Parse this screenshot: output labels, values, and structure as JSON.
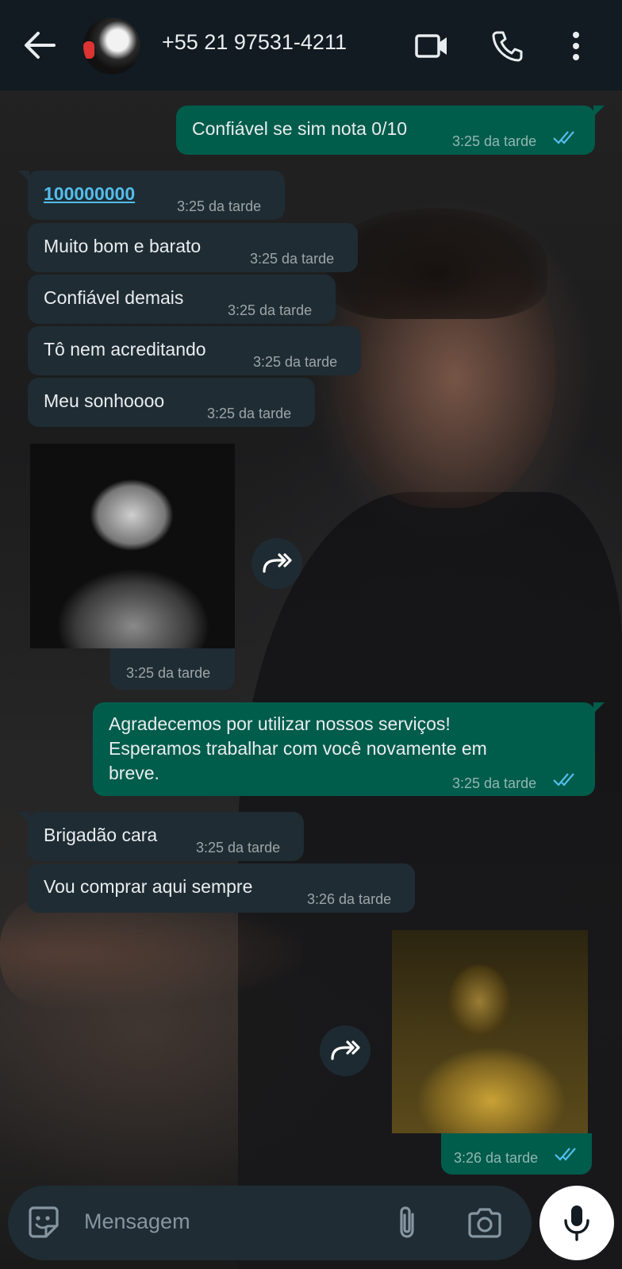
{
  "header": {
    "contact": "+55 21 97531-4211",
    "icons": [
      "back-arrow-icon",
      "video-call-icon",
      "voice-call-icon",
      "more-options-icon"
    ]
  },
  "messages": [
    {
      "dir": "out",
      "text": "Confiável se sim nota 0/10",
      "time": "3:25 da tarde",
      "status": "read"
    },
    {
      "dir": "in",
      "text": "100000000",
      "time": "3:25 da tarde",
      "link": true
    },
    {
      "dir": "in",
      "text": "Muito bom e barato",
      "time": "3:25 da tarde"
    },
    {
      "dir": "in",
      "text": "Confiável demais",
      "time": "3:25 da tarde"
    },
    {
      "dir": "in",
      "text": "Tô nem acreditando",
      "time": "3:25 da tarde"
    },
    {
      "dir": "in",
      "text": "Meu sonhoooo",
      "time": "3:25 da tarde"
    },
    {
      "dir": "in",
      "type": "image",
      "time": "3:25 da tarde"
    },
    {
      "dir": "out",
      "lines": [
        "Agradecemos por utilizar nossos serviços!",
        "Esperamos trabalhar com você novamente em",
        "breve."
      ],
      "time": "3:25 da tarde",
      "status": "read"
    },
    {
      "dir": "in",
      "text": "Brigadão cara",
      "time": "3:25 da tarde"
    },
    {
      "dir": "in",
      "text": "Vou comprar aqui sempre",
      "time": "3:26 da tarde"
    },
    {
      "dir": "out",
      "type": "image",
      "time": "3:26 da tarde",
      "status": "read"
    }
  ],
  "composer": {
    "placeholder": "Mensagem",
    "icons": [
      "emoji-sticker-icon",
      "attach-icon",
      "camera-icon",
      "mic-icon"
    ]
  },
  "colors": {
    "header_bg": "#111b21",
    "incoming_bubble": "#1f2c34",
    "outgoing_bubble": "#005c4b",
    "read_ticks": "#53bdeb"
  }
}
